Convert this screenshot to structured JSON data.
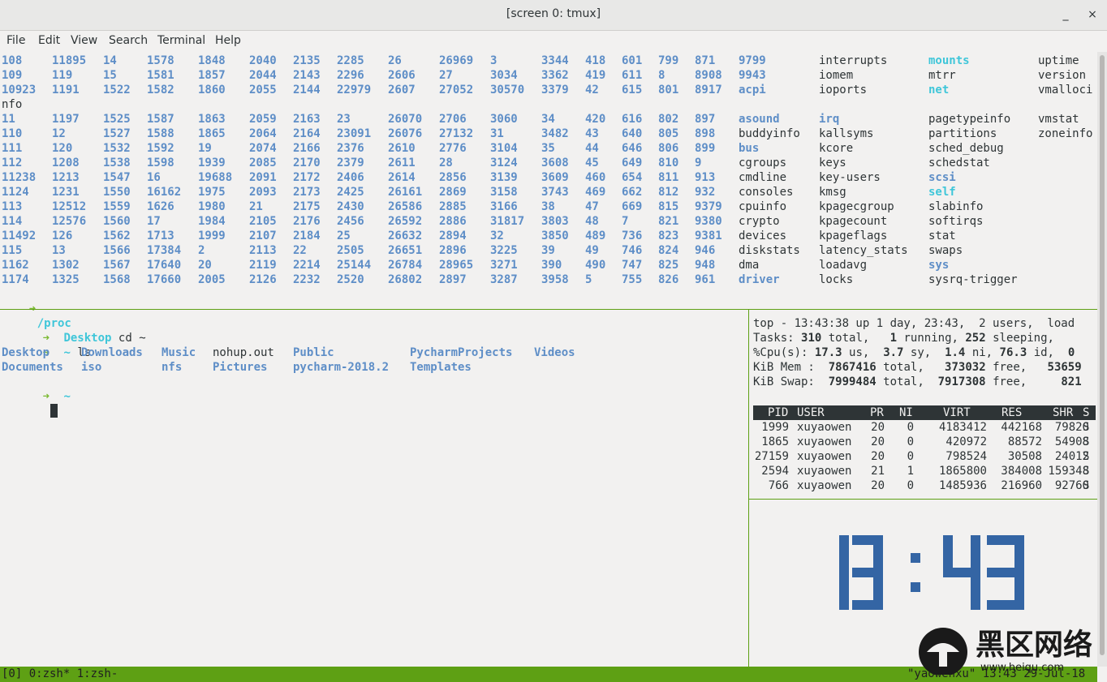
{
  "window": {
    "title": "[screen 0: tmux]",
    "minimize": "_",
    "close": "×"
  },
  "menu": [
    "File",
    "Edit",
    "View",
    "Search",
    "Terminal",
    "Help"
  ],
  "proc_listing": {
    "rows": [
      [
        "108",
        "11895",
        "14",
        "1578",
        "1848",
        "2040",
        "2135",
        "2285",
        "26",
        "26969",
        "3",
        "3344",
        "418",
        "601",
        "799",
        "871",
        "9799",
        "interrupts",
        "mounts",
        "uptime"
      ],
      [
        "109",
        "119",
        "15",
        "1581",
        "1857",
        "2044",
        "2143",
        "2296",
        "2606",
        "27",
        "3034",
        "3362",
        "419",
        "611",
        "8",
        "8908",
        "9943",
        "iomem",
        "mtrr",
        "version"
      ],
      [
        "10923",
        "1191",
        "1522",
        "1582",
        "1860",
        "2055",
        "2144",
        "22979",
        "2607",
        "27052",
        "30570",
        "3379",
        "42",
        "615",
        "801",
        "8917",
        "acpi",
        "ioports",
        "net",
        "vmalloci"
      ],
      [
        "nfo"
      ],
      [
        "11",
        "1197",
        "1525",
        "1587",
        "1863",
        "2059",
        "2163",
        "23",
        "26070",
        "2706",
        "3060",
        "34",
        "420",
        "616",
        "802",
        "897",
        "asound",
        "irq",
        "pagetypeinfo",
        "vmstat"
      ],
      [
        "110",
        "12",
        "1527",
        "1588",
        "1865",
        "2064",
        "2164",
        "23091",
        "26076",
        "27132",
        "31",
        "3482",
        "43",
        "640",
        "805",
        "898",
        "buddyinfo",
        "kallsyms",
        "partitions",
        "zoneinfo"
      ],
      [
        "111",
        "120",
        "1532",
        "1592",
        "19",
        "2074",
        "2166",
        "2376",
        "2610",
        "2776",
        "3104",
        "35",
        "44",
        "646",
        "806",
        "899",
        "bus",
        "kcore",
        "sched_debug",
        ""
      ],
      [
        "112",
        "1208",
        "1538",
        "1598",
        "1939",
        "2085",
        "2170",
        "2379",
        "2611",
        "28",
        "3124",
        "3608",
        "45",
        "649",
        "810",
        "9",
        "cgroups",
        "keys",
        "schedstat",
        ""
      ],
      [
        "11238",
        "1213",
        "1547",
        "16",
        "19688",
        "2091",
        "2172",
        "2406",
        "2614",
        "2856",
        "3139",
        "3609",
        "460",
        "654",
        "811",
        "913",
        "cmdline",
        "key-users",
        "scsi",
        ""
      ],
      [
        "1124",
        "1231",
        "1550",
        "16162",
        "1975",
        "2093",
        "2173",
        "2425",
        "26161",
        "2869",
        "3158",
        "3743",
        "469",
        "662",
        "812",
        "932",
        "consoles",
        "kmsg",
        "self",
        ""
      ],
      [
        "113",
        "12512",
        "1559",
        "1626",
        "1980",
        "21",
        "2175",
        "2430",
        "26586",
        "2885",
        "3166",
        "38",
        "47",
        "669",
        "815",
        "9379",
        "cpuinfo",
        "kpagecgroup",
        "slabinfo",
        ""
      ],
      [
        "114",
        "12576",
        "1560",
        "17",
        "1984",
        "2105",
        "2176",
        "2456",
        "26592",
        "2886",
        "31817",
        "3803",
        "48",
        "7",
        "821",
        "9380",
        "crypto",
        "kpagecount",
        "softirqs",
        ""
      ],
      [
        "11492",
        "126",
        "1562",
        "1713",
        "1999",
        "2107",
        "2184",
        "25",
        "26632",
        "2894",
        "32",
        "3850",
        "489",
        "736",
        "823",
        "9381",
        "devices",
        "kpageflags",
        "stat",
        ""
      ],
      [
        "115",
        "13",
        "1566",
        "17384",
        "2",
        "2113",
        "22",
        "2505",
        "26651",
        "2896",
        "3225",
        "39",
        "49",
        "746",
        "824",
        "946",
        "diskstats",
        "latency_stats",
        "swaps",
        ""
      ],
      [
        "1162",
        "1302",
        "1567",
        "17640",
        "20",
        "2119",
        "2214",
        "25144",
        "26784",
        "28965",
        "3271",
        "390",
        "490",
        "747",
        "825",
        "948",
        "dma",
        "loadavg",
        "sys",
        ""
      ],
      [
        "1174",
        "1325",
        "1568",
        "17660",
        "2005",
        "2126",
        "2232",
        "2520",
        "26802",
        "2897",
        "3287",
        "3958",
        "5",
        "755",
        "826",
        "961",
        "driver",
        "locks",
        "sysrq-trigger",
        ""
      ]
    ],
    "prompt_arrow": "➜",
    "prompt_dir": "/proc"
  },
  "left_pane": {
    "line1": {
      "arrow": "➜",
      "dir": "Desktop",
      "cmd": "cd ~"
    },
    "line2": {
      "arrow": "➜",
      "dir": "~",
      "cmd": "ls"
    },
    "ls_row1": [
      "Desktop",
      "Downloads",
      "Music",
      "nohup.out",
      "Public",
      "PycharmProjects",
      "Videos"
    ],
    "ls_row2": [
      "Documents",
      "iso",
      "nfs",
      "Pictures",
      "pycharm-2018.2",
      "Templates"
    ],
    "line3": {
      "arrow": "➜",
      "dir": "~"
    }
  },
  "top": {
    "line1": "top - 13:43:38 up 1 day, 23:43,  2 users,  load",
    "tasks": {
      "label": "Tasks:",
      "total": "310",
      "total_l": "total,",
      "running": "1",
      "running_l": "running,",
      "sleeping": "252",
      "sleeping_l": "sleeping,"
    },
    "cpu": {
      "label": "%Cpu(s):",
      "us": "17.3",
      "us_l": "us,",
      "sy": "3.7",
      "sy_l": "sy,",
      "ni": "1.4",
      "ni_l": "ni,",
      "id": "76.3",
      "id_l": "id,",
      "wa": "0"
    },
    "mem": {
      "label": "KiB Mem :",
      "total": "7867416",
      "total_l": "total,",
      "free": "373032",
      "free_l": "free,",
      "used": "53659"
    },
    "swap": {
      "label": "KiB Swap:",
      "total": "7999484",
      "total_l": "total,",
      "free": "7917308",
      "free_l": "free,",
      "used": "821"
    },
    "headers": [
      "PID",
      "USER",
      "PR",
      "NI",
      "VIRT",
      "RES",
      "SHR",
      "S"
    ],
    "procs": [
      [
        "1999",
        "xuyaowen",
        "20",
        "0",
        "4183412",
        "442168",
        "79820",
        "S"
      ],
      [
        "1865",
        "xuyaowen",
        "20",
        "0",
        "420972",
        "88572",
        "54908",
        "S"
      ],
      [
        "27159",
        "xuyaowen",
        "20",
        "0",
        "798524",
        "30508",
        "24012",
        "S"
      ],
      [
        "2594",
        "xuyaowen",
        "21",
        "1",
        "1865800",
        "384008",
        "159348",
        "S"
      ],
      [
        "766",
        "xuyaowen",
        "20",
        "0",
        "1485936",
        "216960",
        "92760",
        "S"
      ]
    ]
  },
  "clock": {
    "time": "13:43",
    "color": "#3465a4"
  },
  "status": {
    "left": "[0] 0:zsh* 1:zsh-",
    "right": "\"yaowenxu\" 13:43 29-Jul-18"
  },
  "watermark": {
    "text": "黑区网络",
    "sub": "www.heiqu.com"
  }
}
